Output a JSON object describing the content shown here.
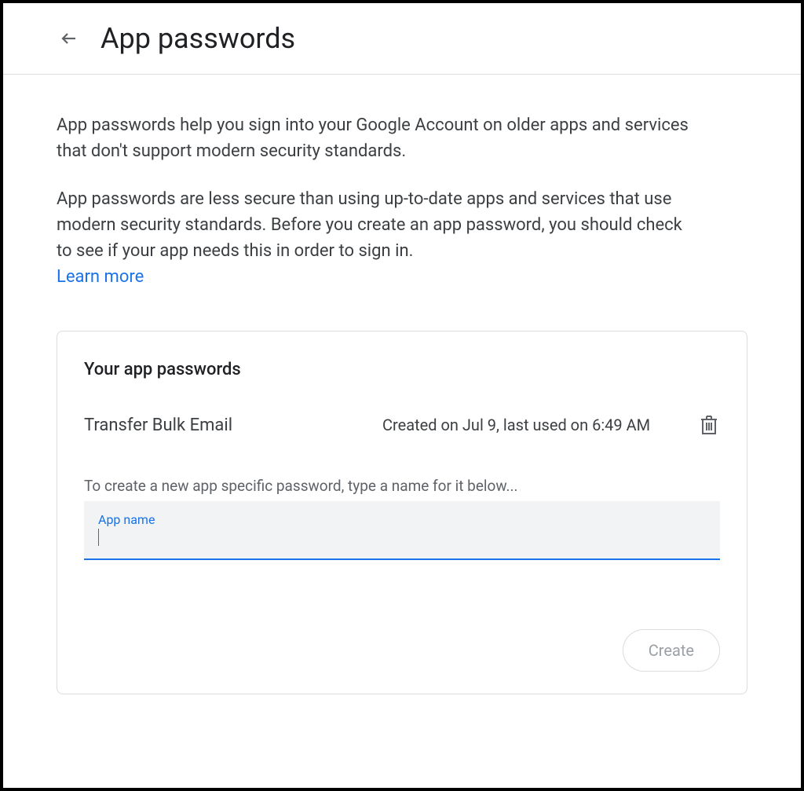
{
  "header": {
    "title": "App passwords"
  },
  "intro": {
    "description": "App passwords help you sign into your Google Account on older apps and services that don't support modern security standards.",
    "warning": "App passwords are less secure than using up-to-date apps and services that use modern security standards. Before you create an app password, you should check to see if your app needs this in order to sign in.",
    "learn_more": "Learn more"
  },
  "card": {
    "title": "Your app passwords",
    "passwords": [
      {
        "name": "Transfer Bulk Email",
        "meta": "Created on Jul 9, last used on 6:49 AM"
      }
    ],
    "create_hint": "To create a new app specific password, type a name for it below...",
    "input_label": "App name",
    "input_value": "",
    "create_button": "Create"
  }
}
